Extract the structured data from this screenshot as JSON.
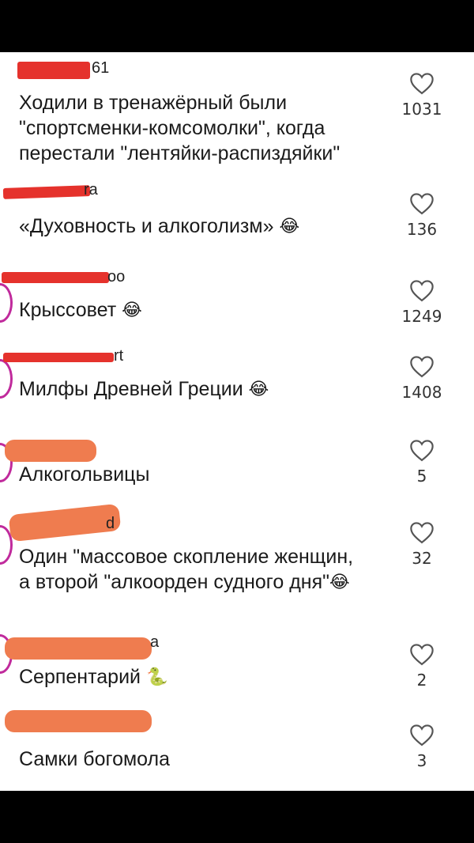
{
  "comments": [
    {
      "username": "61",
      "text": "Ходили в тренажёрный были \n\"спортсменки-комсомолки\", когда \nперестали \"лентяйки-распиздяйки\"",
      "emoji": "",
      "likes": "1031"
    },
    {
      "username": "ra",
      "text": "«Духовность и алкоголизм»",
      "emoji": "😂",
      "likes": "136"
    },
    {
      "username": "оо",
      "text": "Крыссовет",
      "emoji": "😂",
      "likes": "1249"
    },
    {
      "username": "rt",
      "text": "Милфы Древней Греции",
      "emoji": "😂",
      "likes": "1408"
    },
    {
      "username": "",
      "text": "Алкогольвицы",
      "emoji": "",
      "likes": "5"
    },
    {
      "username": "d",
      "text": "Один \"массовое скопление женщин, \nа второй \"алкоорден судного дня\"",
      "emoji": "😂",
      "likes": "32"
    },
    {
      "username": "a",
      "text": "Серпентарий",
      "emoji": "🐍",
      "likes": "2"
    },
    {
      "username": "",
      "text": "Самки богомола",
      "emoji": "",
      "likes": "3"
    }
  ],
  "icons": {
    "like": "heart-outline-icon"
  },
  "colors": {
    "redaction_red": "#e5322c",
    "redaction_orange": "#ef7c4f",
    "avatar_ring": "#c02a9c"
  }
}
